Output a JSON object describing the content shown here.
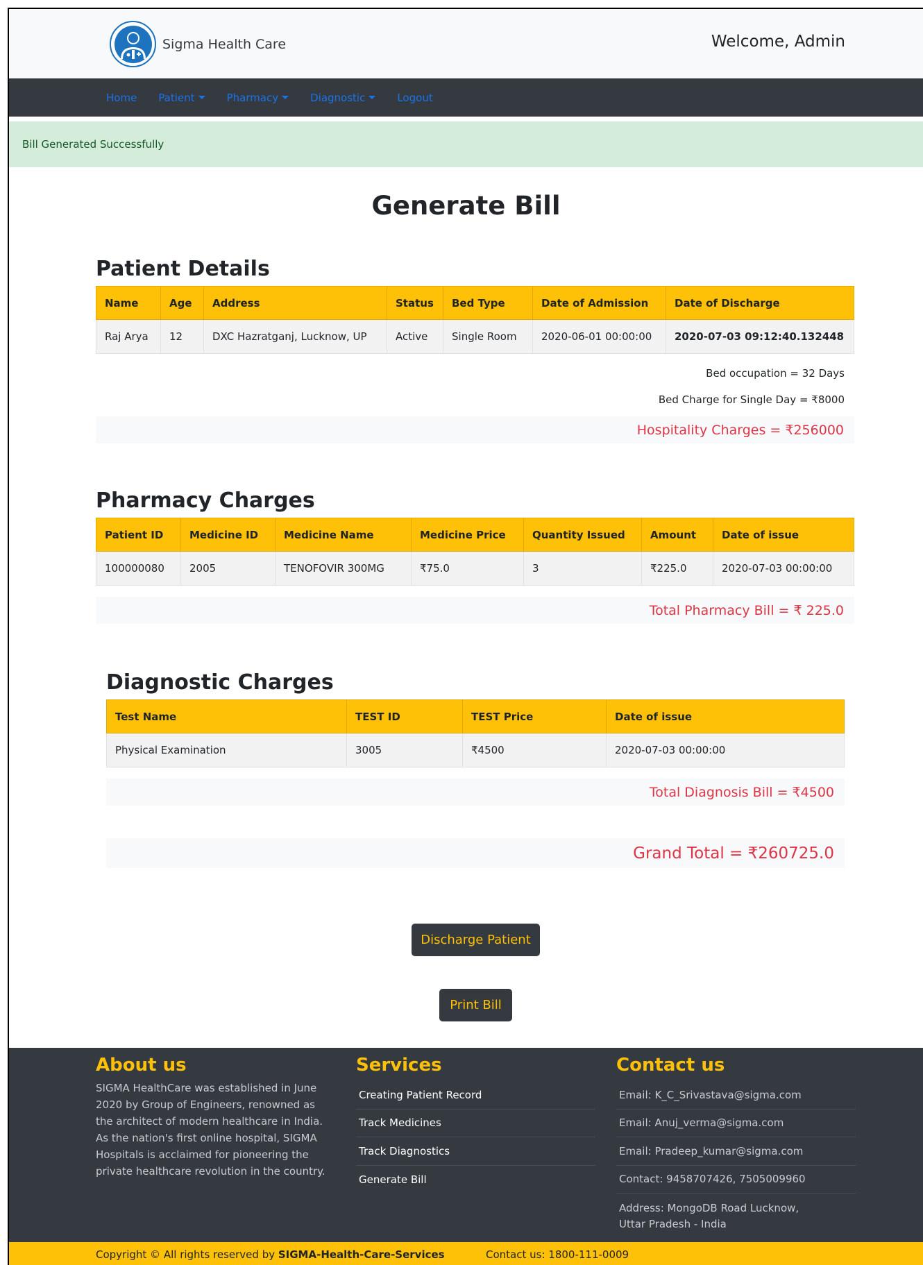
{
  "header": {
    "brand": "Sigma Health Care",
    "welcome": "Welcome, Admin"
  },
  "nav": {
    "items": [
      {
        "label": "Home",
        "dropdown": false
      },
      {
        "label": "Patient",
        "dropdown": true
      },
      {
        "label": "Pharmacy",
        "dropdown": true
      },
      {
        "label": "Diagnostic",
        "dropdown": true
      },
      {
        "label": "Logout",
        "dropdown": false
      }
    ]
  },
  "alert": "Bill Generated Successfully",
  "page_title": "Generate Bill",
  "patient": {
    "heading": "Patient Details",
    "columns": [
      "Name",
      "Age",
      "Address",
      "Status",
      "Bed Type",
      "Date of Admission",
      "Date of Discharge"
    ],
    "row": [
      "Raj Arya",
      "12",
      "DXC Hazratganj, Lucknow, UP",
      "Active",
      "Single Room",
      "2020-06-01 00:00:00",
      "2020-07-03 09:12:40.132448"
    ],
    "bed_occupation": "Bed occupation = 32 Days",
    "bed_charge": "Bed Charge for Single Day = ₹8000",
    "total": "Hospitality Charges = ₹256000"
  },
  "pharmacy": {
    "heading": "Pharmacy Charges",
    "columns": [
      "Patient ID",
      "Medicine ID",
      "Medicine Name",
      "Medicine Price",
      "Quantity Issued",
      "Amount",
      "Date of issue"
    ],
    "row": [
      "100000080",
      "2005",
      "TENOFOVIR 300MG",
      "₹75.0",
      "3",
      "₹225.0",
      "2020-07-03 00:00:00"
    ],
    "total": "Total Pharmacy Bill = ₹ 225.0"
  },
  "diagnostic": {
    "heading": "Diagnostic Charges",
    "columns": [
      "Test Name",
      "TEST ID",
      "TEST Price",
      "Date of issue"
    ],
    "row": [
      "Physical Examination",
      "3005",
      "₹4500",
      "2020-07-03 00:00:00"
    ],
    "total": "Total Diagnosis Bill = ₹4500"
  },
  "grand_total": "Grand Total = ₹260725.0",
  "buttons": {
    "discharge": "Discharge Patient",
    "print": "Print Bill"
  },
  "footer": {
    "about_title": "About us",
    "about_text": "SIGMA HealthCare was established in June 2020 by Group of Engineers, renowned as the architect of modern healthcare in India. As the nation's first online hospital, SIGMA Hospitals is acclaimed for pioneering the private healthcare revolution in the country.",
    "services_title": "Services",
    "services": [
      "Creating Patient Record",
      "Track Medicines",
      "Track Diagnostics",
      "Generate Bill"
    ],
    "contact_title": "Contact us",
    "contacts": [
      "Email: K_C_Srivastava@sigma.com",
      "Email: Anuj_verma@sigma.com",
      "Email: Pradeep_kumar@sigma.com",
      "Contact: 9458707426, 7505009960",
      "Address: MongoDB Road Lucknow, Uttar Pradesh - India"
    ]
  },
  "copyright": {
    "prefix": "Copyright © All rights reserved by ",
    "owner": "SIGMA-Health-Care-Services",
    "contact": "Contact us: 1800-111-0009"
  },
  "colors": {
    "accent": "#ffc107",
    "dark": "#343a40",
    "danger": "#dc3545",
    "link": "#1a73e8",
    "success_bg": "#d4edda"
  }
}
